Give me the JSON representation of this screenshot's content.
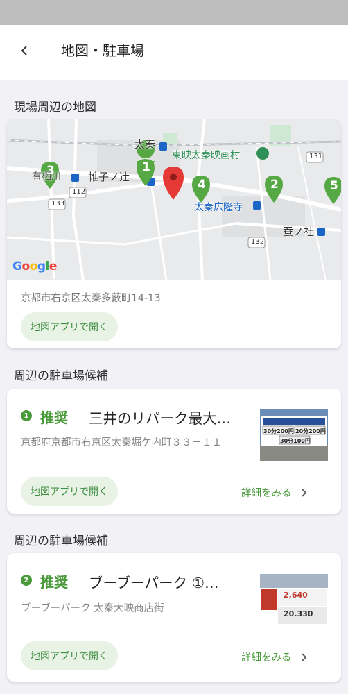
{
  "header": {
    "title": "地図・駐車場"
  },
  "map_section": {
    "title": "現場周辺の地図",
    "address": "京都市右京区太秦多薮町14-13",
    "open_app_label": "地図アプリで開く",
    "logo": "Google",
    "labels": {
      "uzumasa": "太秦",
      "toei": "東映太秦映画村",
      "katabira": "帷子ノ辻",
      "arisu": "有栖川",
      "koryuji": "太秦広隆寺",
      "kaiko": "蚕ノ社",
      "r131": "131",
      "r112": "112",
      "r133": "133",
      "r132": "132"
    },
    "markers": [
      "1",
      "2",
      "3",
      "4",
      "5"
    ]
  },
  "parking": [
    {
      "section_title": "周辺の駐車場候補",
      "rank": "1",
      "badge": "推奨",
      "name": "三井のリパーク最大…",
      "address": "京都府京都市右京区太秦堀ケ内町３３－１１",
      "open_app_label": "地図アプリで開く",
      "detail_label": "詳細をみる",
      "thumb_text": [
        "30分200円",
        "20分200円",
        "30分100円"
      ]
    },
    {
      "section_title": "周辺の駐車場候補",
      "rank": "2",
      "badge": "推奨",
      "name": "ブーブーパーク ①…",
      "address": "ブーブーパーク 太秦大映商店街",
      "open_app_label": "地図アプリで開く",
      "detail_label": "詳細をみる",
      "thumb_text": [
        "2,640",
        "20.330"
      ]
    }
  ],
  "colors": {
    "accent": "#4a9a3c",
    "pill_bg": "#e8f2e5",
    "marker": "#55a843",
    "pin": "#e53935"
  }
}
